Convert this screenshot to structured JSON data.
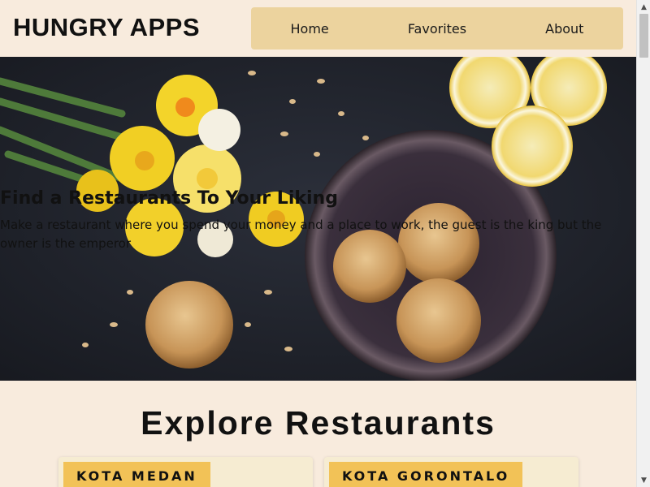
{
  "header": {
    "brand": "HUNGRY APPS",
    "nav": [
      {
        "label": "Home"
      },
      {
        "label": "Favorites"
      },
      {
        "label": "About"
      }
    ]
  },
  "hero": {
    "title": "Find a Restaurants To Your Liking",
    "text": "Make a restaurant where you spend your money and a place to work, the guest is the king but the owner is the emperor"
  },
  "explore": {
    "title": "Explore Restaurants",
    "cards": [
      {
        "city": "KOTA MEDAN"
      },
      {
        "city": "KOTA GORONTALO"
      }
    ]
  },
  "colors": {
    "page_bg": "#f8ebdd",
    "nav_bg": "#ecd39e",
    "tag_bg": "#f2c257",
    "card_bg": "#f6ecd2"
  },
  "icons": {
    "scroll_up": "triangle-up-icon",
    "scroll_down": "triangle-down-icon"
  }
}
